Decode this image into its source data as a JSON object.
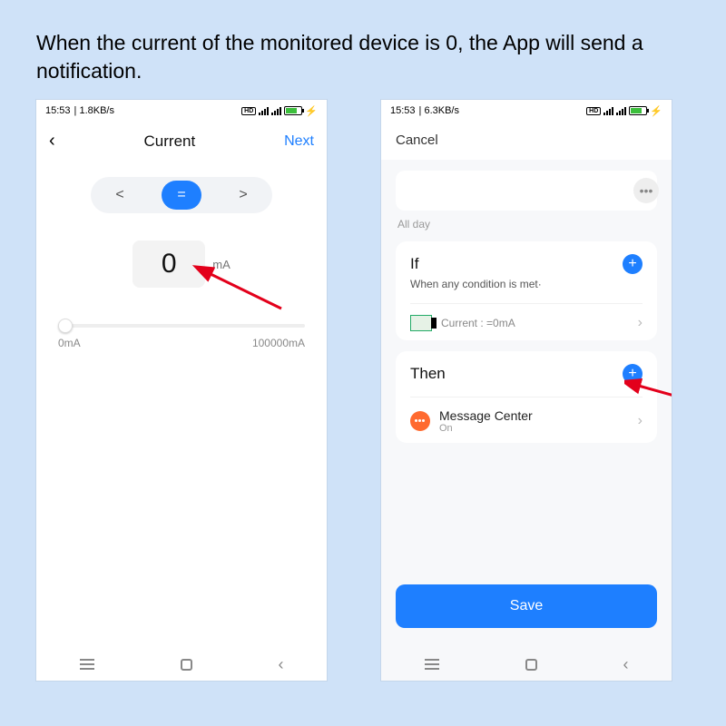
{
  "caption": "When the current of the monitored device is 0, the App will send a notification.",
  "left": {
    "status": {
      "time": "15:53",
      "net": "1.8KB/s"
    },
    "title": "Current",
    "next": "Next",
    "ops": {
      "lt": "<",
      "eq": "=",
      "gt": ">"
    },
    "value": "0",
    "unit": "mA",
    "range_min": "0mA",
    "range_max": "100000mA"
  },
  "right": {
    "status": {
      "time": "15:53",
      "net": "6.3KB/s"
    },
    "cancel": "Cancel",
    "all_day": "All day",
    "if_title": "If",
    "if_sub": "When any condition is met·",
    "if_item": "Current : =0mA",
    "then_title": "Then",
    "msg_title": "Message Center",
    "msg_sub": "On",
    "save": "Save"
  }
}
